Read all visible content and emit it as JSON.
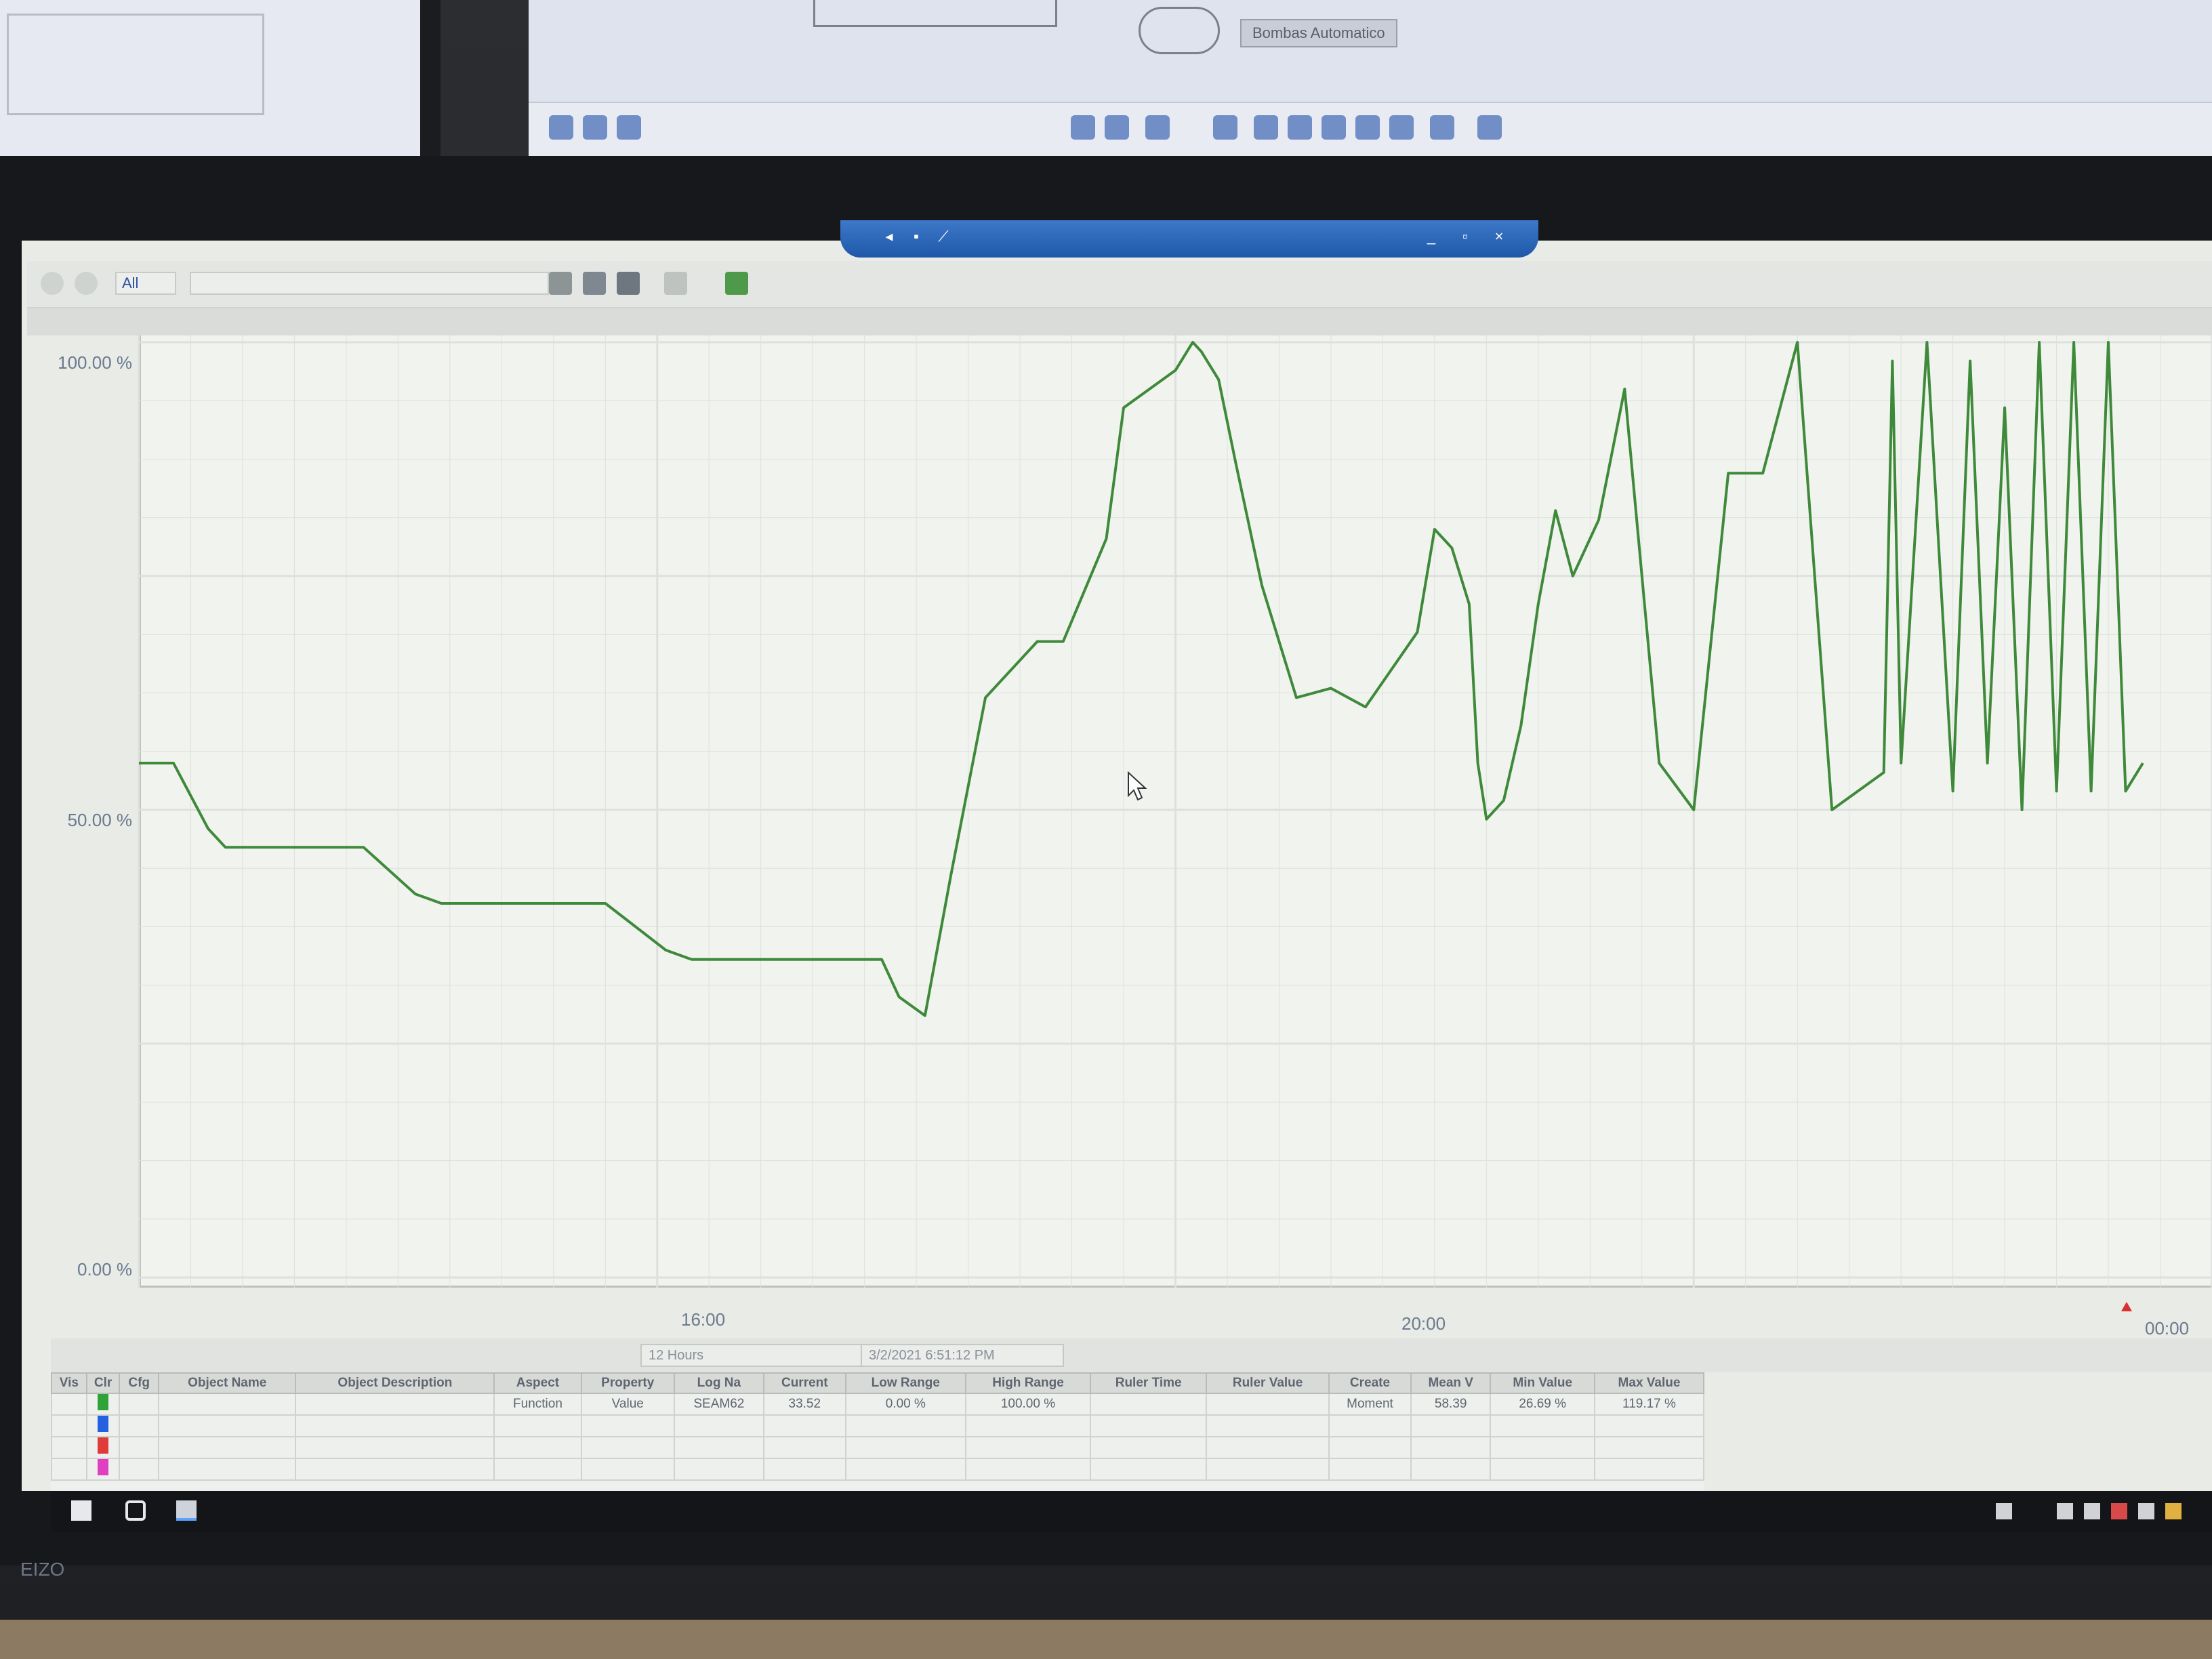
{
  "top_monitor": {
    "tag_label": "Bombas Automatico"
  },
  "chart_data": {
    "type": "line",
    "title": "",
    "xlabel": "",
    "ylabel": "",
    "y_ticks": [
      "100.00 %",
      "50.00 %",
      "0.00 %"
    ],
    "ylim": [
      0,
      100
    ],
    "x_ticks": [
      "16:00",
      "20:00",
      "00:00"
    ],
    "grid": true,
    "series": [
      {
        "color": "#3f8a3a",
        "x": [
          12.0,
          12.2,
          12.4,
          12.5,
          12.65,
          12.8,
          13.3,
          13.6,
          13.75,
          13.9,
          14.7,
          15.05,
          15.2,
          15.3,
          16.3,
          16.4,
          16.55,
          16.7,
          16.9,
          17.2,
          17.35,
          17.6,
          17.7,
          17.85,
          18.0,
          18.1,
          18.15,
          18.25,
          18.35,
          18.5,
          18.7,
          18.9,
          19.1,
          19.4,
          19.5,
          19.6,
          19.7,
          19.75,
          19.8,
          19.9,
          20.0,
          20.1,
          20.2,
          20.3,
          20.45,
          20.6,
          20.8,
          21.0,
          21.2,
          21.4,
          21.6,
          21.8,
          22.1,
          22.15,
          22.2,
          22.35,
          22.5,
          22.6,
          22.7,
          22.8,
          22.9,
          23.0,
          23.1,
          23.2,
          23.3,
          23.4,
          23.5,
          23.6
        ],
        "y": [
          55,
          55,
          48,
          46,
          46,
          46,
          46,
          41,
          40,
          40,
          40,
          35,
          34,
          34,
          34,
          30,
          28,
          43,
          62,
          68,
          68,
          79,
          93,
          95,
          97,
          100,
          99,
          96,
          87,
          74,
          62,
          63,
          61,
          69,
          80,
          78,
          72,
          55,
          49,
          51,
          59,
          72,
          82,
          75,
          81,
          95,
          55,
          50,
          86,
          86,
          100,
          50,
          54,
          98,
          55,
          100,
          52,
          98,
          55,
          93,
          50,
          100,
          52,
          100,
          52,
          100,
          52,
          55
        ]
      }
    ]
  },
  "toolbar": {
    "aspect_combo": "All",
    "time_combo": "12 Hours",
    "date_combo": "3/2/2021 6:51:12 PM"
  },
  "table": {
    "headers": [
      "Vis",
      "Clr",
      "Cfg",
      "Object Name",
      "Object Description",
      "Aspect",
      "Property",
      "Log Na",
      "Current",
      "Low Range",
      "High Range",
      "Ruler Time",
      "Ruler Value",
      "Create",
      "Mean V",
      "Min Value",
      "Max Value"
    ],
    "row1": {
      "aspect": "Function",
      "property": "Value",
      "log_name": "SEAM62",
      "current": "33.52",
      "low_range": "0.00 %",
      "high_range": "100.00 %",
      "create": "Moment",
      "mean": "58.39",
      "min": "26.69 %",
      "max": "119.17 %"
    },
    "row_colors": [
      "#2fa33a",
      "#2460e0",
      "#e03a3a",
      "#e040c0"
    ]
  },
  "brand": "EIZO"
}
